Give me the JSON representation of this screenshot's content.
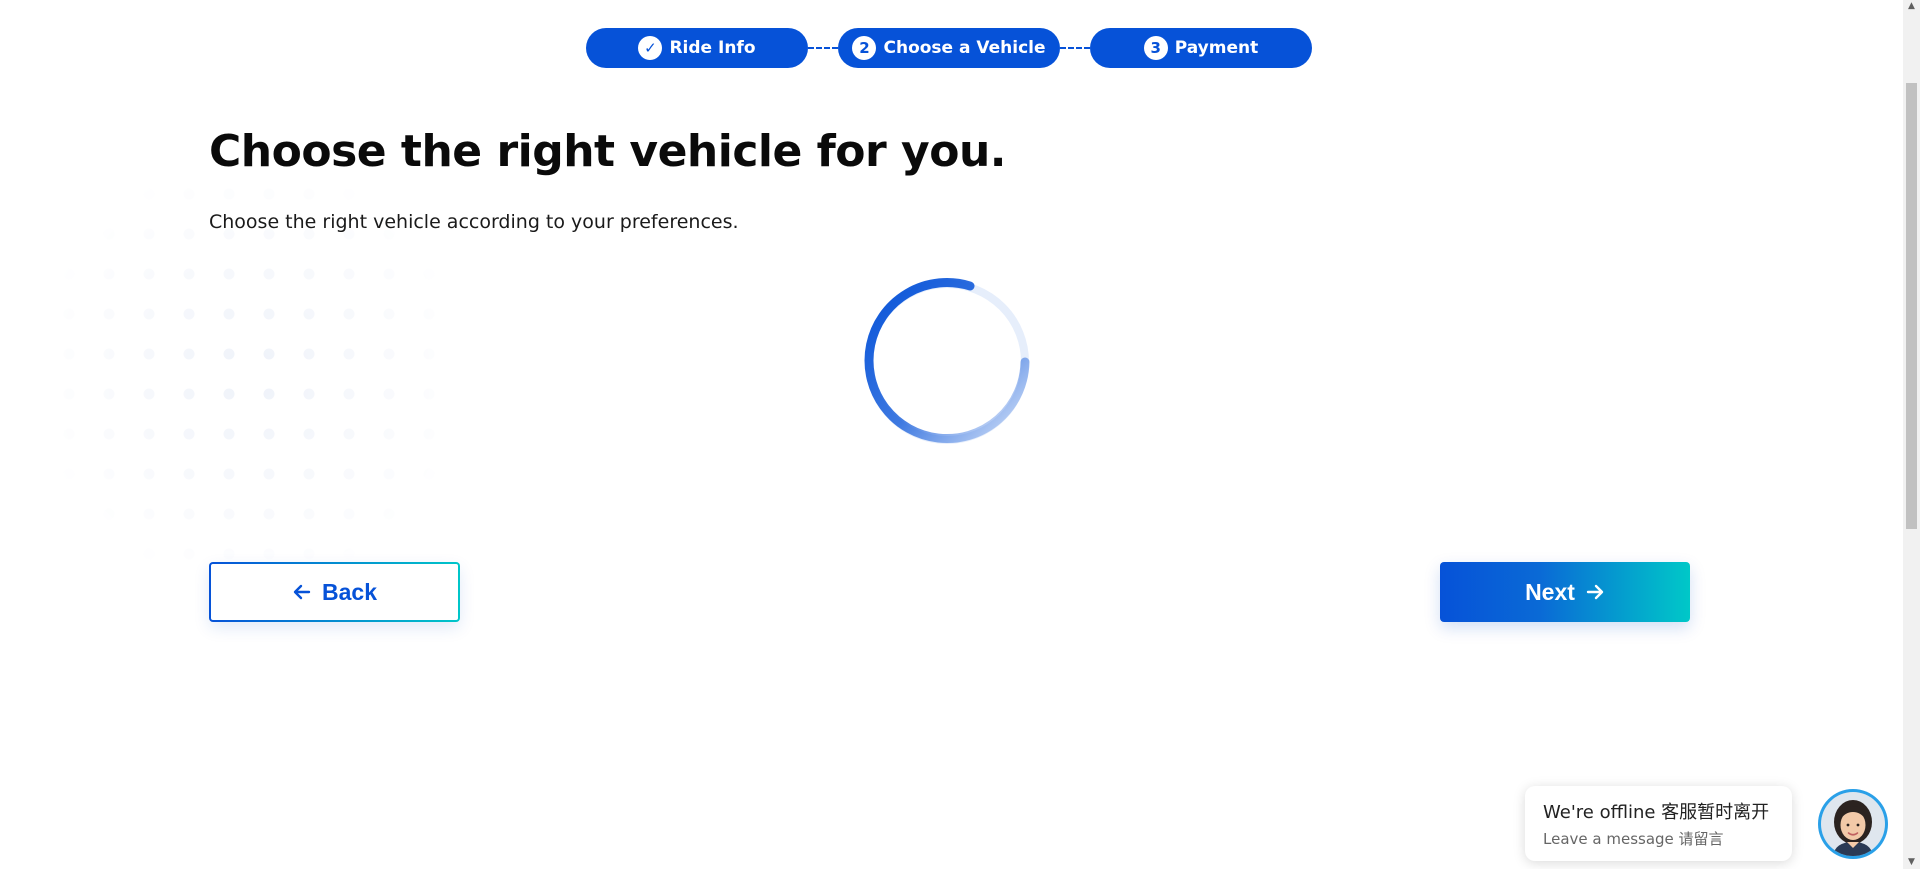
{
  "stepper": {
    "steps": [
      {
        "label": "Ride Info",
        "marker": "✓",
        "status": "completed"
      },
      {
        "label": "Choose a Vehicle",
        "marker": "2",
        "status": "current"
      },
      {
        "label": "Payment",
        "marker": "3",
        "status": "upcoming"
      }
    ]
  },
  "page": {
    "title": "Choose the right vehicle for you.",
    "subtitle": "Choose the right vehicle according to your preferences."
  },
  "loading": {
    "icon": "spinner-icon",
    "accent": "#0652d8"
  },
  "actions": {
    "back_label": "Back",
    "back_icon": "arrow-left-icon",
    "next_label": "Next",
    "next_icon": "arrow-right-icon"
  },
  "chat": {
    "status_title": "We're offline 客服暂时离开",
    "status_sub": "Leave a message 请留言",
    "avatar": "support-agent-avatar"
  },
  "colors": {
    "brand_blue": "#0652d8",
    "accent_teal": "#00c8c8"
  }
}
